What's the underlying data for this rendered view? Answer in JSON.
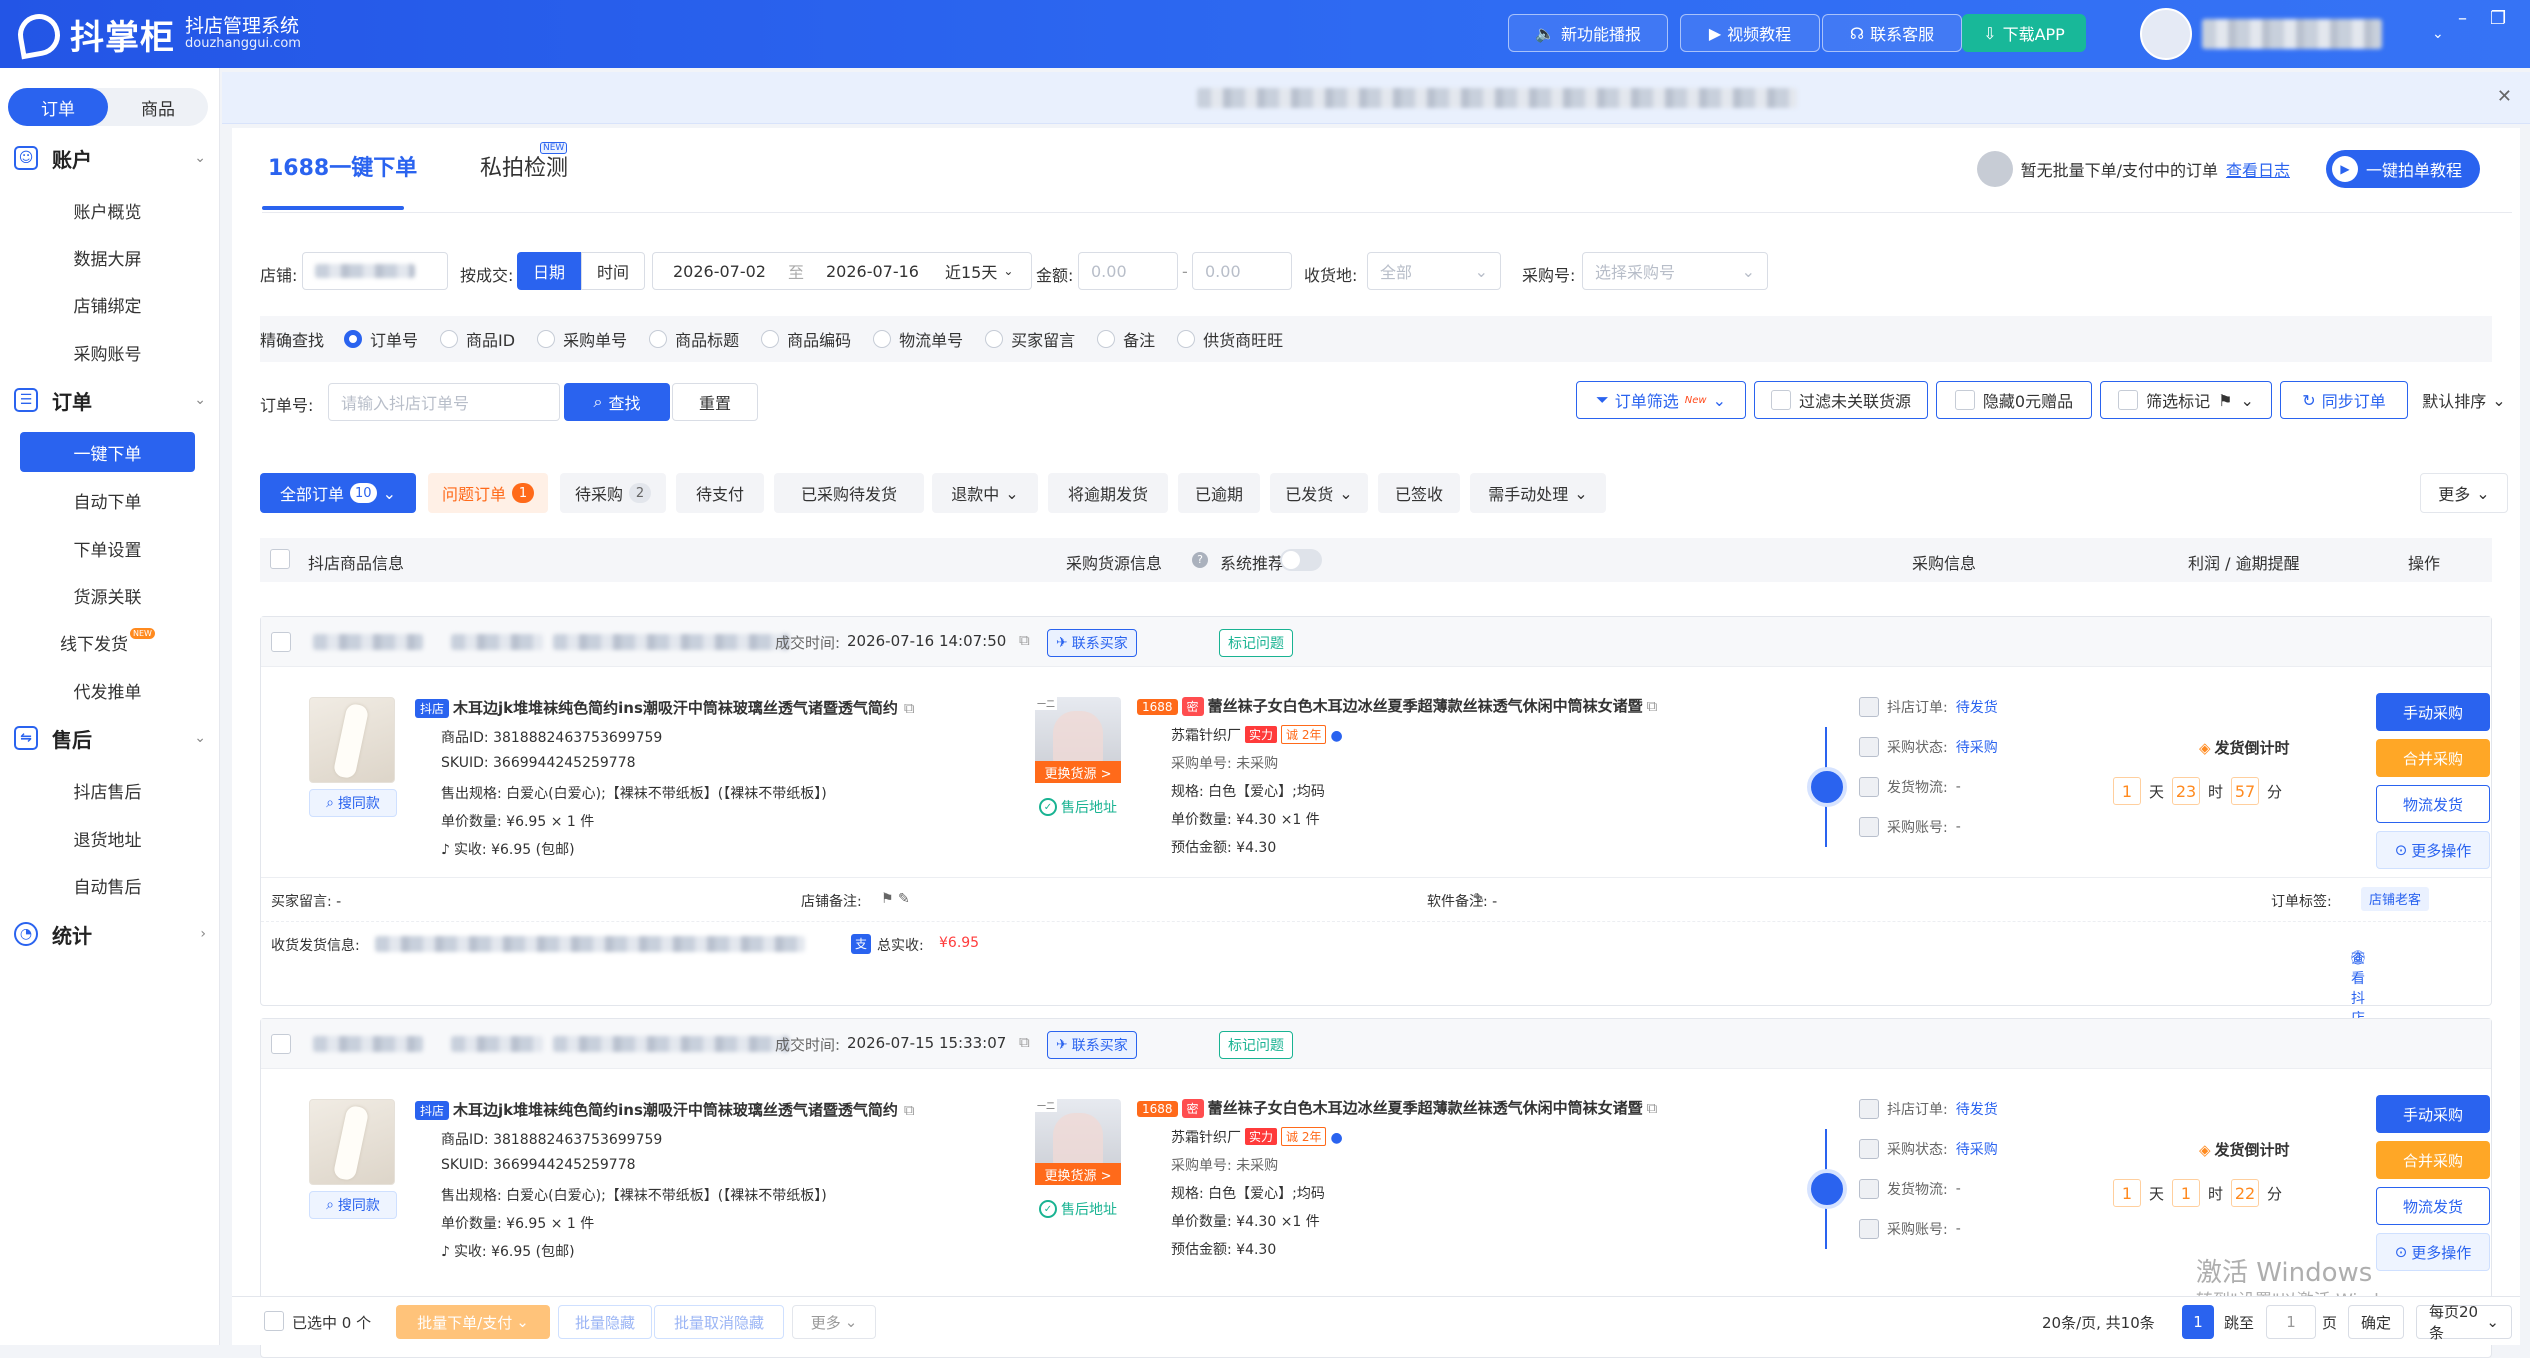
{
  "app": {
    "name": "抖掌柜",
    "subtitle": "抖店管理系统",
    "domain": "douzhanggui.com"
  },
  "topbar": {
    "buttons": [
      "新功能播报",
      "视频教程",
      "联系客服",
      "下载APP"
    ]
  },
  "sidebar": {
    "segment": [
      "订单",
      "商品"
    ],
    "groups": [
      {
        "title": "账户",
        "items": [
          "账户概览",
          "数据大屏",
          "店铺绑定",
          "采购账号"
        ]
      },
      {
        "title": "订单",
        "items": [
          "一键下单",
          "自动下单",
          "下单设置",
          "货源关联",
          "线下发货",
          "代发推单"
        ]
      },
      {
        "title": "售后",
        "items": [
          "抖店售后",
          "退货地址",
          "自动售后"
        ]
      },
      {
        "title": "统计",
        "items": []
      }
    ]
  },
  "tabs": [
    "1688一键下单",
    "私拍检测"
  ],
  "tab_new": "NEW",
  "header_right": {
    "text": "暂无批量下单/支付中的订单",
    "link": "查看日志",
    "button": "一键拍单教程"
  },
  "filters": {
    "shop_label": "店铺:",
    "by_label": "按成交:",
    "by_options": [
      "日期",
      "时间"
    ],
    "date_from": "2026-07-02",
    "date_sep": "至",
    "date_to": "2026-07-16",
    "range": "近15天",
    "amount_label": "金额:",
    "amount_min": "0.00",
    "amount_max": "0.00",
    "region_label": "收货地:",
    "region_value": "全部",
    "buyer_label": "采购号:",
    "buyer_placeholder": "选择采购号"
  },
  "exact": {
    "label": "精确查找",
    "options": [
      "订单号",
      "商品ID",
      "采购单号",
      "商品标题",
      "商品编码",
      "物流单号",
      "买家留言",
      "备注",
      "供货商旺旺"
    ]
  },
  "search": {
    "label": "订单号:",
    "placeholder": "请输入抖店订单号",
    "search_btn": "查找",
    "reset_btn": "重置",
    "right": [
      "订单筛选",
      "过滤未关联货源",
      "隐藏0元赠品",
      "筛选标记",
      "同步订单",
      "默认排序"
    ],
    "new": "New"
  },
  "status_tabs": [
    {
      "label": "全部订单",
      "count": "10"
    },
    {
      "label": "问题订单",
      "count": "1"
    },
    {
      "label": "待采购",
      "count": "2"
    },
    {
      "label": "待支付"
    },
    {
      "label": "已采购待发货"
    },
    {
      "label": "退款中"
    },
    {
      "label": "将逾期发货"
    },
    {
      "label": "已逾期"
    },
    {
      "label": "已发货"
    },
    {
      "label": "已签收"
    },
    {
      "label": "需手动处理"
    },
    {
      "label": "更多"
    }
  ],
  "table_head": [
    "抖店商品信息",
    "采购货源信息",
    "系统推荐",
    "采购信息",
    "利润 / 逾期提醒",
    "操作"
  ],
  "orders": [
    {
      "time_label": "成交时间:",
      "time": "2026-07-16 14:07:50",
      "contact": "联系买家",
      "mark": "标记问题",
      "product": {
        "platform": "抖店",
        "title": "木耳边jk堆堆袜纯色简约ins潮吸汗中筒袜玻璃丝透气诸暨透气简约",
        "id": "商品ID: 3818882463753699759",
        "sku": "SKUID: 3669944245259778",
        "spec": "售出规格: 白爱心(白爱心);【裸袜不带纸板】(【裸袜不带纸板】)",
        "unit": "单价数量: ¥6.95 × 1 件",
        "paid": "实收: ¥6.95 (包邮)",
        "same": "搜同款"
      },
      "source": {
        "platform": "1688",
        "title": "蕾丝袜子女白色木耳边冰丝夏季超薄款丝袜透气休闲中筒袜女诸暨",
        "shop": "苏霜针织厂",
        "tag1": "实力",
        "tag2": "诚 2年",
        "purchase_no": "采购单号: 未采购",
        "spec": "规格: 白色【爱心】;均码",
        "unit": "单价数量: ¥4.30 ×1 件",
        "est": "预估金额: ¥4.30",
        "swap": "更换货源 >",
        "after": "售后地址",
        "seal": "密"
      },
      "status": [
        {
          "k": "抖店订单:",
          "v": "待发货"
        },
        {
          "k": "采购状态:",
          "v": "待采购"
        },
        {
          "k": "发货物流:",
          "v": "-"
        },
        {
          "k": "采购账号:",
          "v": "-"
        }
      ],
      "countdown": {
        "title": "发货倒计时",
        "d": "1",
        "d_u": "天",
        "h": "23",
        "h_u": "时",
        "m": "57",
        "m_u": "分"
      },
      "actions": [
        "手动采购",
        "合并采购",
        "物流发货",
        "更多操作"
      ],
      "foot": {
        "msg": "买家留言:  -",
        "shop_note": "店铺备注:",
        "soft_note": "软件备注:  -",
        "tag_label": "订单标签:",
        "tag": "店铺老客",
        "addr": "收货发货信息:",
        "total": "总实收:",
        "total_v": "¥6.95",
        "view": "查看抖店订单 >"
      }
    },
    {
      "time_label": "成交时间:",
      "time": "2026-07-15 15:33:07",
      "contact": "联系买家",
      "mark": "标记问题",
      "product": {
        "platform": "抖店",
        "title": "木耳边jk堆堆袜纯色简约ins潮吸汗中筒袜玻璃丝透气诸暨透气简约",
        "id": "商品ID: 3818882463753699759",
        "sku": "SKUID: 3669944245259778",
        "spec": "售出规格: 白爱心(白爱心);【裸袜不带纸板】(【裸袜不带纸板】)",
        "unit": "单价数量: ¥6.95 × 1 件",
        "paid": "实收: ¥6.95 (包邮)",
        "same": "搜同款"
      },
      "source": {
        "platform": "1688",
        "title": "蕾丝袜子女白色木耳边冰丝夏季超薄款丝袜透气休闲中筒袜女诸暨",
        "shop": "苏霜针织厂",
        "tag1": "实力",
        "tag2": "诚 2年",
        "purchase_no": "采购单号: 未采购",
        "spec": "规格: 白色【爱心】;均码",
        "unit": "单价数量: ¥4.30 ×1 件",
        "est": "预估金额: ¥4.30",
        "swap": "更换货源 >",
        "after": "售后地址",
        "seal": "密"
      },
      "status": [
        {
          "k": "抖店订单:",
          "v": "待发货"
        },
        {
          "k": "采购状态:",
          "v": "待采购"
        },
        {
          "k": "发货物流:",
          "v": "-"
        },
        {
          "k": "采购账号:",
          "v": "-"
        }
      ],
      "countdown": {
        "title": "发货倒计时",
        "d": "1",
        "d_u": "天",
        "h": "1",
        "h_u": "时",
        "m": "22",
        "m_u": "分"
      },
      "actions": [
        "手动采购",
        "合并采购",
        "物流发货",
        "更多操作"
      ]
    }
  ],
  "footer": {
    "selected": "已选中 0 个",
    "buttons": [
      "批量下单/支付",
      "批量隐藏",
      "批量取消隐藏",
      "更多"
    ],
    "summary": "20条/页, 共10条",
    "page": "1",
    "jump": "跳至",
    "jump_val": "1",
    "page_unit": "页",
    "confirm": "确定",
    "per_page": "每页20条"
  },
  "watermark": {
    "line1": "激活 Windows",
    "line2": "转到\"设置\"以激活 Windows。"
  }
}
